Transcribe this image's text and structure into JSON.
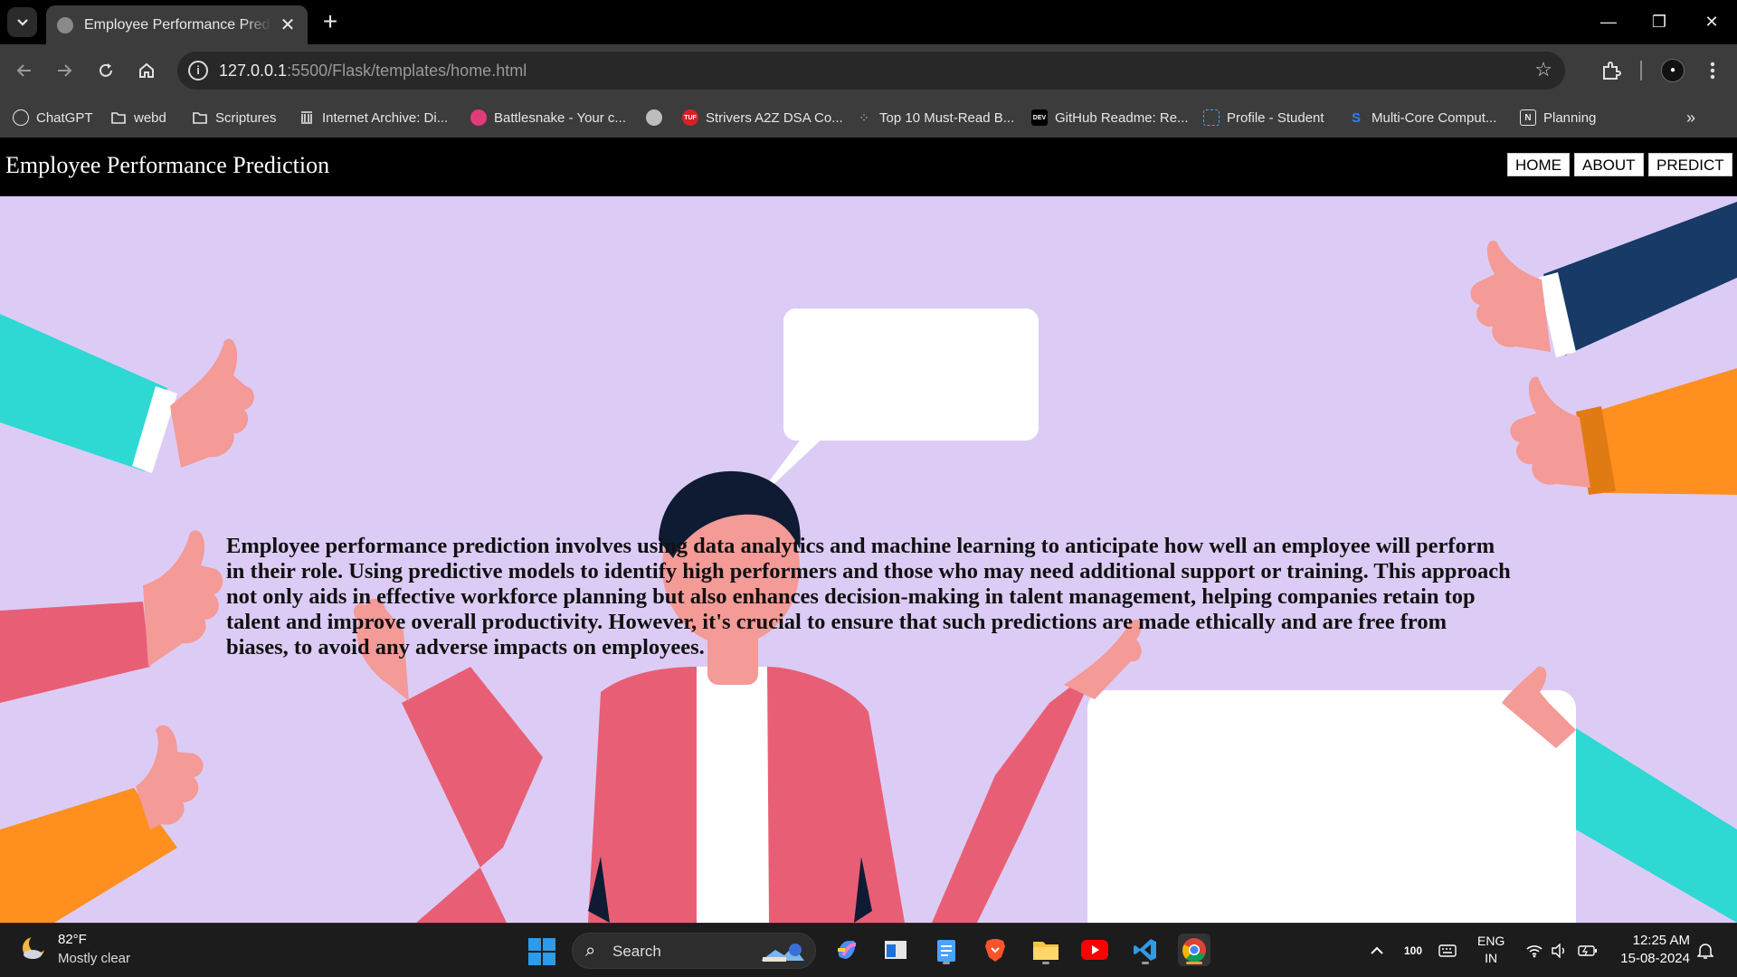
{
  "browser": {
    "tab_title": "Employee Performance Prediction",
    "tab_close": "✕",
    "new_tab": "+",
    "url_host": "127.0.0.1",
    "url_path": ":5500/Flask/templates/home.html",
    "window_controls": {
      "minimize": "—",
      "restore": "❐",
      "close": "✕"
    },
    "bookmarks": [
      {
        "label": "ChatGPT",
        "icon": "chatgpt-icon"
      },
      {
        "label": "webd",
        "icon": "folder-icon"
      },
      {
        "label": "Scriptures",
        "icon": "folder-icon"
      },
      {
        "label": "Internet Archive: Di...",
        "icon": "archive-icon"
      },
      {
        "label": "Battlesnake - Your c...",
        "icon": "battlesnake-icon"
      },
      {
        "label": "",
        "icon": "globe-icon"
      },
      {
        "label": "Strivers A2Z DSA Co...",
        "icon": "tuf-icon"
      },
      {
        "label": "Top 10 Must-Read B...",
        "icon": "dots-icon"
      },
      {
        "label": "GitHub Readme: Re...",
        "icon": "dev-icon"
      },
      {
        "label": "Profile - Student",
        "icon": "profile-page-icon"
      },
      {
        "label": "Multi-Core Comput...",
        "icon": "s-icon"
      },
      {
        "label": "Planning",
        "icon": "notion-icon"
      }
    ],
    "bookmarks_more": "»"
  },
  "page": {
    "site_title": "Employee Performance Prediction",
    "nav": [
      "HOME",
      "ABOUT",
      "PREDICT"
    ],
    "hero_text": "Employee performance prediction involves using data analytics and machine learning to anticipate how well an employee will perform in their role. Using predictive models to identify high performers and those who may need additional support or training. This approach not only aids in effective workforce planning but also enhances decision-making in talent management, helping companies retain top talent and improve overall productivity. However, it's crucial to ensure that such predictions are made ethically and are free from biases, to avoid any adverse impacts on employees."
  },
  "taskbar": {
    "weather_temp": "82°F",
    "weather_desc": "Mostly clear",
    "search_label": "Search",
    "tray_battery": "100",
    "lang_line1": "ENG",
    "lang_line2": "IN",
    "time": "12:25 AM",
    "date": "15-08-2024"
  },
  "colors": {
    "hero_bg": "#dcccf5",
    "shirt": "#e85f75",
    "skin": "#f49a97",
    "teal": "#2ed8d3",
    "orange": "#ff8f1f",
    "navy": "#173a66"
  }
}
